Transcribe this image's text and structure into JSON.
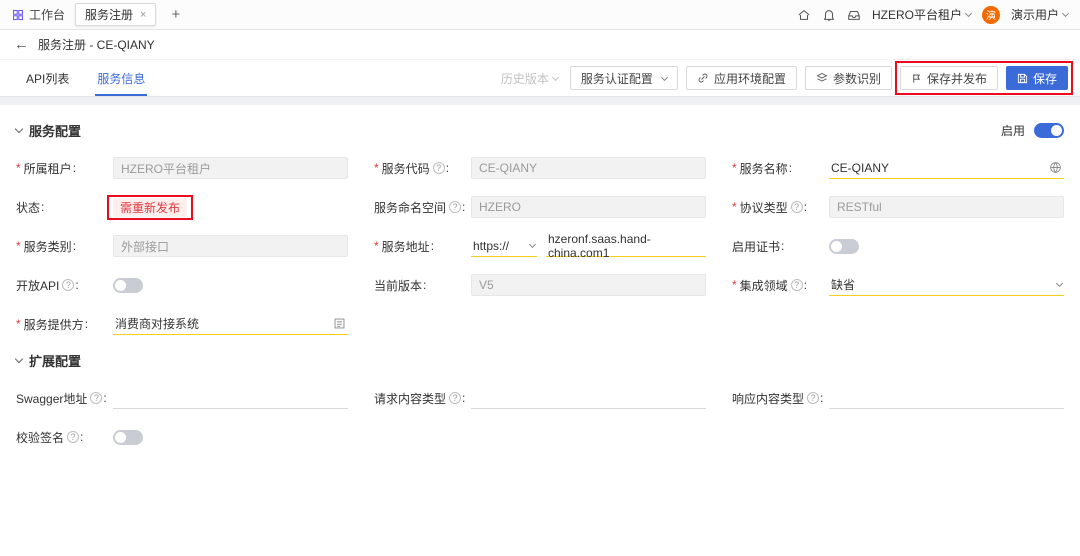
{
  "colors": {
    "primary": "#3b6bd8",
    "dirty_underline": "#f7ce1a",
    "annotation_red": "#ee0a1e",
    "status_red": "#e4393c",
    "avatar_orange": "#f56a00"
  },
  "window_tabs": {
    "workbench": "工作台",
    "active_tab": "服务注册",
    "close_glyph": "×",
    "add_glyph": "+"
  },
  "account": {
    "tenant": "HZERO平台租户",
    "user": "演示用户",
    "avatar": "演"
  },
  "page_header": {
    "back_glyph": "←",
    "title": "服务注册 - CE-QIANY"
  },
  "nav_tabs": {
    "api_list": "API列表",
    "service_info": "服务信息"
  },
  "toolbar": {
    "history": "历史版本",
    "auth_config": "服务认证配置",
    "env_config": "应用环境配置",
    "param_recognition": "参数识别",
    "save_publish": "保存并发布",
    "save": "保存"
  },
  "sections": {
    "service_config": "服务配置",
    "extend_config": "扩展配置",
    "enable_label": "启用"
  },
  "fields": {
    "tenant": {
      "label": "所属租户",
      "value": "HZERO平台租户"
    },
    "code": {
      "label": "服务代码",
      "value": "CE-QIANY"
    },
    "name": {
      "label": "服务名称",
      "value": "CE-QIANY"
    },
    "status": {
      "label": "状态",
      "value": "需重新发布"
    },
    "namespace": {
      "label": "服务命名空间",
      "value": "HZERO"
    },
    "protocol": {
      "label": "协议类型",
      "value": "RESTful"
    },
    "category": {
      "label": "服务类别",
      "value": "外部接口"
    },
    "address": {
      "label": "服务地址",
      "scheme": "https://",
      "value": "hzeronf.saas.hand-china.com1"
    },
    "cert": {
      "label": "启用证书"
    },
    "openapi": {
      "label": "开放API"
    },
    "version": {
      "label": "当前版本",
      "value": "V5"
    },
    "domain": {
      "label": "集成领域",
      "value": "缺省"
    },
    "provider": {
      "label": "服务提供方",
      "value": "消费商对接系统"
    },
    "swagger": {
      "label": "Swagger地址",
      "value": ""
    },
    "req_type": {
      "label": "请求内容类型",
      "value": ""
    },
    "resp_type": {
      "label": "响应内容类型",
      "value": ""
    },
    "sign": {
      "label": "校验签名"
    }
  }
}
